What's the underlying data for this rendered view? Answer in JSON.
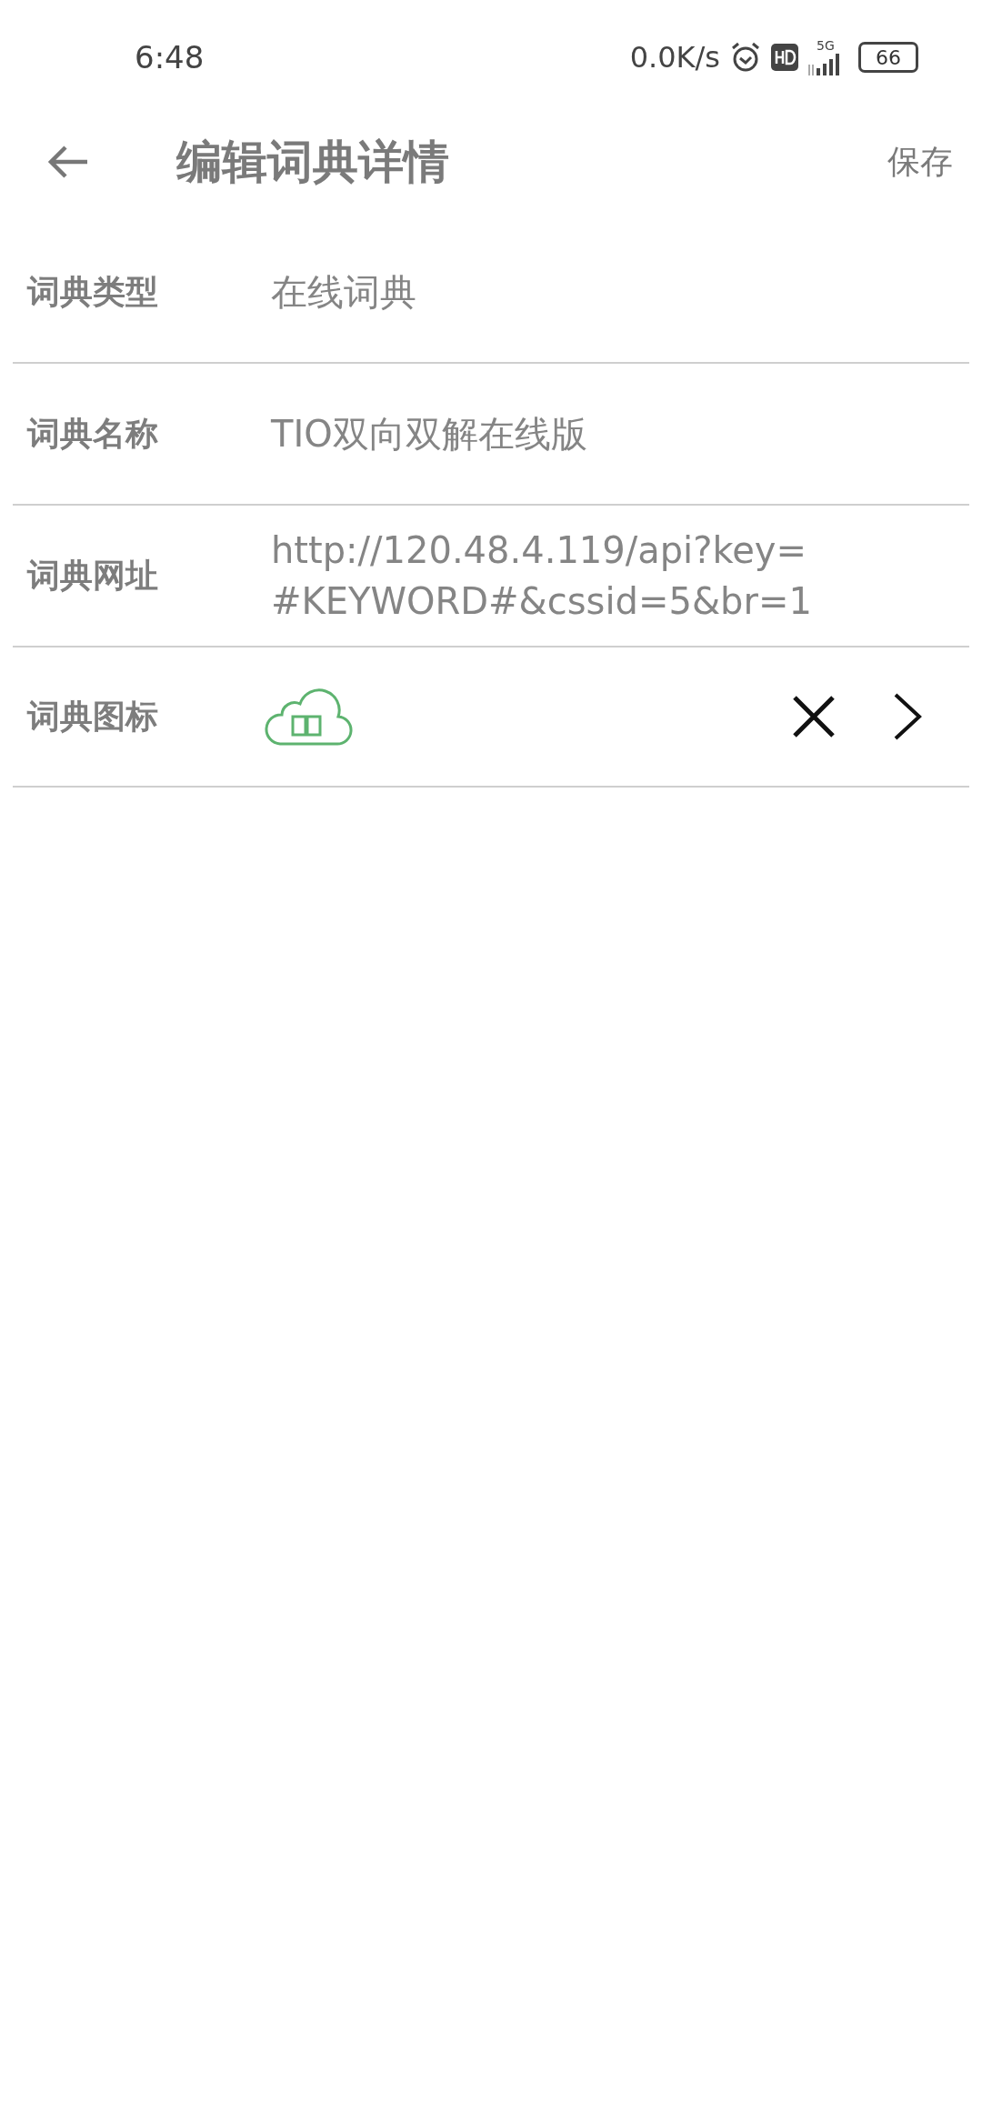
{
  "status_bar": {
    "time": "6:48",
    "speed": "0.0K/s",
    "network": "5G",
    "battery": "66"
  },
  "app_bar": {
    "title": "编辑词典详情",
    "action": "保存"
  },
  "fields": [
    {
      "kind": "text",
      "label": "词典类型",
      "value": [
        "在线词典"
      ]
    },
    {
      "kind": "text",
      "label": "词典名称",
      "value": [
        "TIO双向双解在线版"
      ]
    },
    {
      "kind": "text",
      "label": "词典网址",
      "value": [
        "http://120.48.4.119/api?key=",
        "#KEYWORD#&cssid=5&br=1"
      ]
    },
    {
      "kind": "icon",
      "label": "词典图标"
    }
  ]
}
